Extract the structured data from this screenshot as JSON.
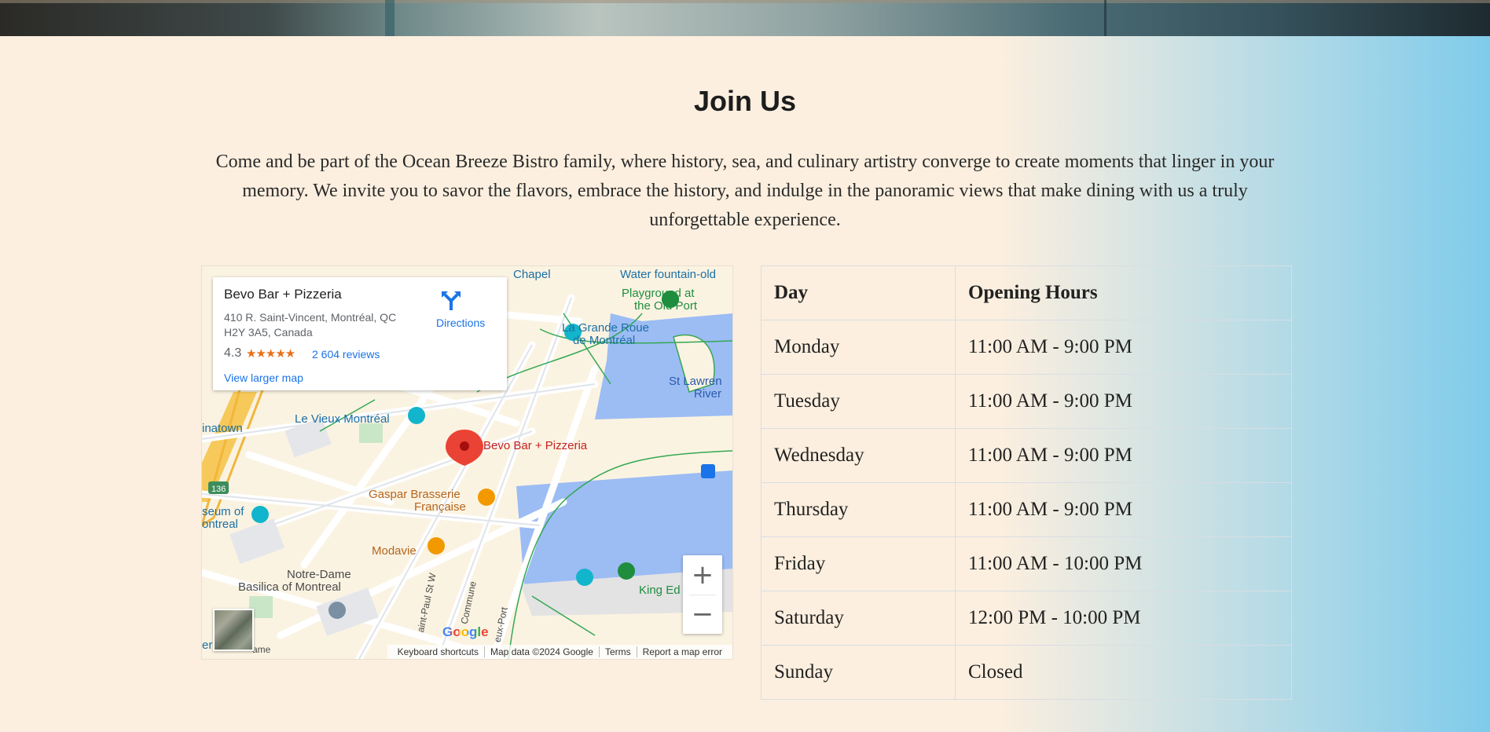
{
  "section": {
    "title": "Join Us",
    "intro": "Come and be part of the Ocean Breeze Bistro family, where history, sea, and culinary artistry converge to create moments that linger in your memory. We invite you to savor the flavors, embrace the history, and indulge in the panoramic views that make dining with us a truly unforgettable experience."
  },
  "map": {
    "place_name": "Bevo Bar + Pizzeria",
    "address_line1": "410 R. Saint-Vincent, Montréal, QC",
    "address_line2": "H2Y 3A5, Canada",
    "rating": "4.3",
    "stars": "★★★★★",
    "reviews": "2 604 reviews",
    "directions": "Directions",
    "view_larger": "View larger map",
    "labels": {
      "chapel": "Chapel",
      "water_fountain": "Water fountain-old",
      "playground_1": "Playground at",
      "playground_2": "the Old Port",
      "grande_roue_1": "La Grande Roue",
      "grande_roue_2": "de Montréal",
      "st_lawrence_1": "St Lawren",
      "st_lawrence_2": "River",
      "vieux_montreal": "Le Vieux Montréal",
      "chinatown": "inatown",
      "pin_label": "Bevo Bar + Pizzeria",
      "gaspar_1": "Gaspar Brasserie",
      "gaspar_2": "Française",
      "museum_1": "seum of",
      "museum_2": "ontreal",
      "modavie": "Modavie",
      "notre_dame_1": "Notre-Dame",
      "notre_dame_2": "Basilica of Montreal",
      "king_edward": "King Ed",
      "route": "136",
      "street_paul": "aint-Paul St W",
      "street_commune": "Commune",
      "street_port": "eux-Port",
      "bottom_left_1": "eries",
      "bottom_left_2": "ame"
    },
    "zoom_in": "+",
    "zoom_out": "−",
    "google": "Google",
    "attribution": [
      "Keyboard shortcuts",
      "Map data ©2024 Google",
      "Terms",
      "Report a map error"
    ]
  },
  "hours": {
    "headers": [
      "Day",
      "Opening Hours"
    ],
    "rows": [
      [
        "Monday",
        "11:00 AM - 9:00 PM"
      ],
      [
        "Tuesday",
        "11:00 AM - 9:00 PM"
      ],
      [
        "Wednesday",
        "11:00 AM - 9:00 PM"
      ],
      [
        "Thursday",
        "11:00 AM - 9:00 PM"
      ],
      [
        "Friday",
        "11:00 AM - 10:00 PM"
      ],
      [
        "Saturday",
        "12:00 PM - 10:00 PM"
      ],
      [
        "Sunday",
        "Closed"
      ]
    ]
  },
  "colors": {
    "link_blue": "#1a73e8",
    "star_orange": "#e7711b",
    "water_blue": "#9cbcf4",
    "park_green": "#34a853",
    "pin_red": "#ea4335"
  }
}
